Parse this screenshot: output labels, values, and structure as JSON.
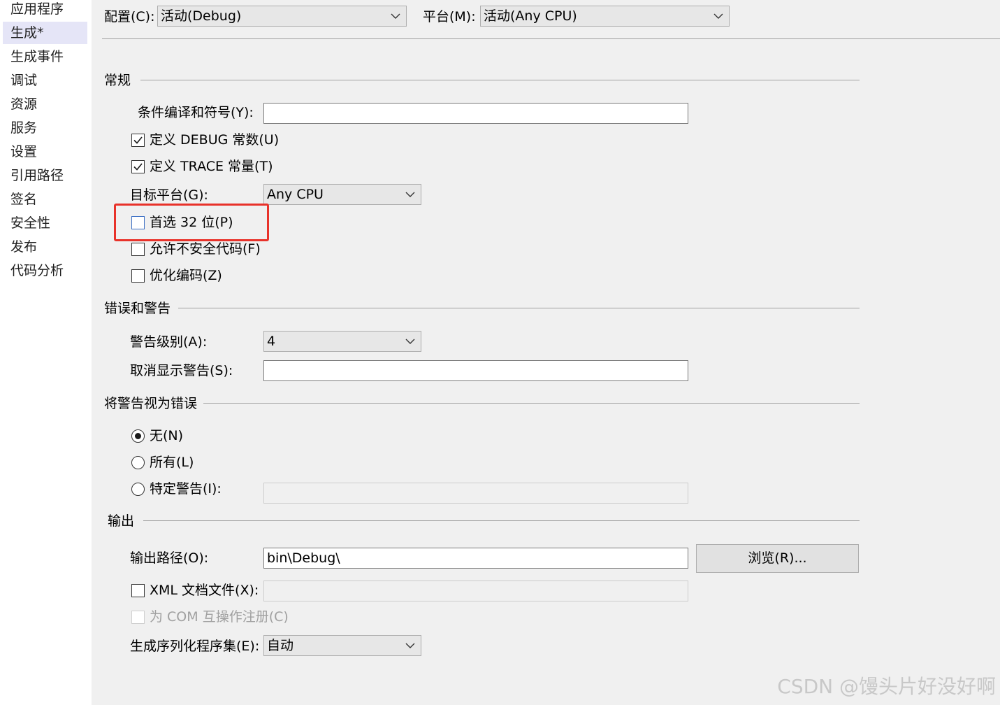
{
  "sidebar": {
    "items": [
      {
        "label": "应用程序",
        "active": false
      },
      {
        "label": "生成*",
        "active": true
      },
      {
        "label": "生成事件",
        "active": false
      },
      {
        "label": "调试",
        "active": false
      },
      {
        "label": "资源",
        "active": false
      },
      {
        "label": "服务",
        "active": false
      },
      {
        "label": "设置",
        "active": false
      },
      {
        "label": "引用路径",
        "active": false
      },
      {
        "label": "签名",
        "active": false
      },
      {
        "label": "安全性",
        "active": false
      },
      {
        "label": "发布",
        "active": false
      },
      {
        "label": "代码分析",
        "active": false
      }
    ]
  },
  "toolbar": {
    "config_label": "配置(C):",
    "config_value": "活动(Debug)",
    "platform_label": "平台(M):",
    "platform_value": "活动(Any CPU)"
  },
  "general": {
    "title": "常规",
    "conditional_symbols_label": "条件编译和符号(Y):",
    "conditional_symbols_value": "",
    "define_debug": {
      "label": "定义 DEBUG 常数(U)",
      "checked": true
    },
    "define_trace": {
      "label": "定义 TRACE 常量(T)",
      "checked": true
    },
    "target_platform_label": "目标平台(G):",
    "target_platform_value": "Any CPU",
    "prefer_32bit": {
      "label": "首选 32 位(P)",
      "checked": false
    },
    "allow_unsafe": {
      "label": "允许不安全代码(F)",
      "checked": false
    },
    "optimize": {
      "label": "优化编码(Z)",
      "checked": false
    }
  },
  "errors": {
    "title": "错误和警告",
    "warning_level_label": "警告级别(A):",
    "warning_level_value": "4",
    "suppress_label": "取消显示警告(S):",
    "suppress_value": ""
  },
  "treat_warnings": {
    "title": "将警告视为错误",
    "none": {
      "label": "无(N)",
      "selected": true
    },
    "all": {
      "label": "所有(L)",
      "selected": false
    },
    "specific": {
      "label": "特定警告(I):",
      "selected": false
    },
    "specific_value": ""
  },
  "output": {
    "title": "输出",
    "path_label": "输出路径(O):",
    "path_value": "bin\\Debug\\",
    "browse_label": "浏览(R)...",
    "xml_doc": {
      "label": "XML 文档文件(X):",
      "checked": false
    },
    "xml_doc_value": "",
    "com_register": {
      "label": "为 COM 互操作注册(C)",
      "checked": false,
      "disabled": true
    },
    "serialization_label": "生成序列化程序集(E):",
    "serialization_value": "自动"
  },
  "watermark": "CSDN @馒头片好没好啊",
  "colors": {
    "highlight": "#e8322a",
    "sidebar_active": "#e5e5f7",
    "background": "#f0f0f0"
  }
}
